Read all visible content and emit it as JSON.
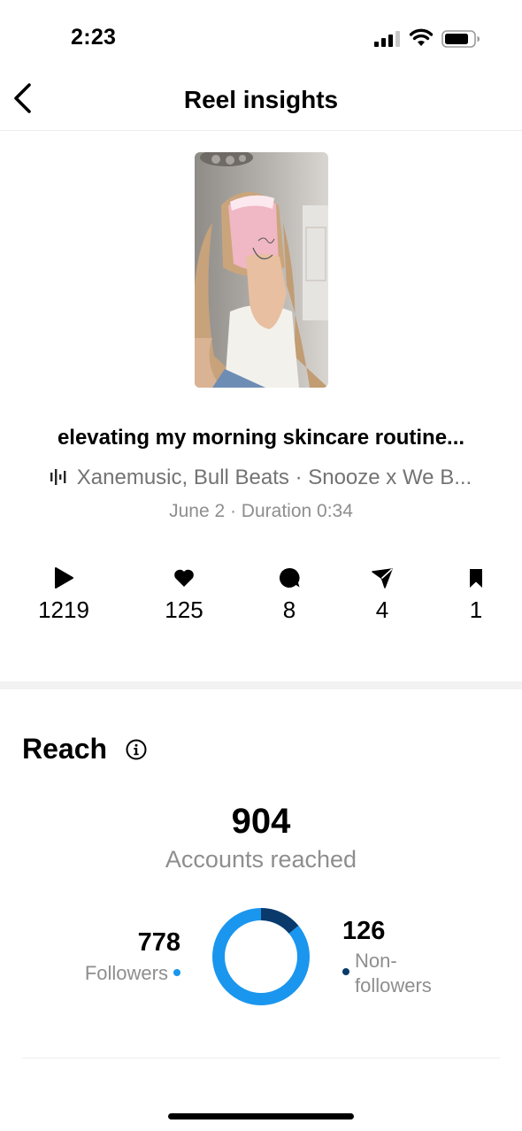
{
  "status_bar": {
    "time": "2:23"
  },
  "header": {
    "title": "Reel insights"
  },
  "reel": {
    "caption": "elevating my morning skincare routine...",
    "audio": "Xanemusic, Bull Beats · Snooze x We B...",
    "meta": "June 2 · Duration 0:34"
  },
  "stats": {
    "plays": "1219",
    "likes": "125",
    "comments": "8",
    "shares": "4",
    "saves": "1"
  },
  "reach": {
    "title": "Reach",
    "total": "904",
    "total_label": "Accounts reached",
    "followers": {
      "value": "778",
      "label": "Followers"
    },
    "non_followers": {
      "value": "126",
      "label": "Non-followers",
      "label_line1": "Non-",
      "label_line2": "followers"
    },
    "colors": {
      "followers": "#1a96ee",
      "non_followers": "#0a3a6b"
    }
  }
}
